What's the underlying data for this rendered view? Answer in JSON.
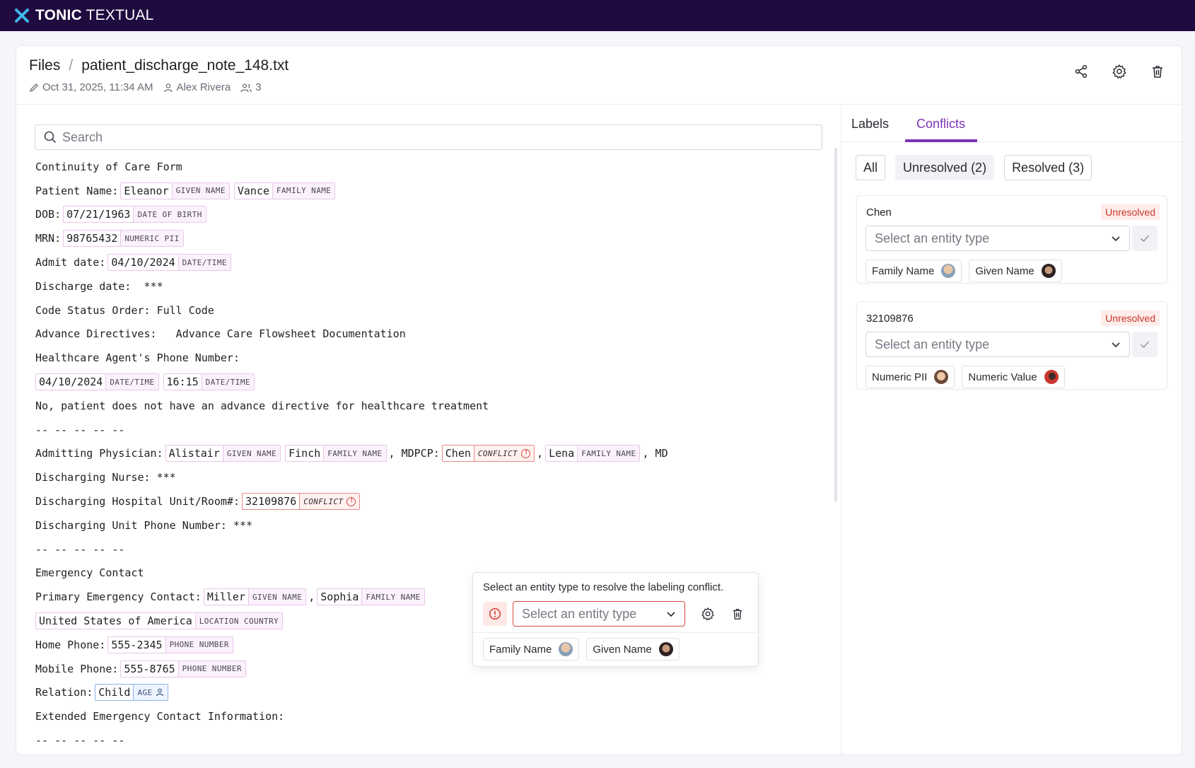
{
  "brand": {
    "name_bold": "TONIC",
    "name_rest": "TEXTUAL"
  },
  "breadcrumb": {
    "root": "Files",
    "separator": "/",
    "file": "patient_discharge_note_148.txt"
  },
  "meta": {
    "edited": "Oct 31, 2025, 11:34 AM",
    "user": "Alex Rivera",
    "collaborators": "3"
  },
  "search": {
    "placeholder": "Search"
  },
  "doc": {
    "l1": "Continuity of Care Form",
    "patient_name_label": "Patient Name:",
    "given1": "Eleanor",
    "given_tag": "GIVEN NAME",
    "family1": "Vance",
    "family_tag": "FAMILY NAME",
    "dob_label": "DOB:",
    "dob": "07/21/1963",
    "dob_tag": "DATE OF BIRTH",
    "mrn_label": "MRN:",
    "mrn": "98765432",
    "numeric_tag": "NUMERIC PII",
    "admit_label": "Admit date:",
    "admit": "04/10/2024",
    "datetime_tag": "DATE/TIME",
    "discharge": "Discharge date:  ***",
    "code": "Code Status Order: Full Code",
    "advance": "Advance Directives:   Advance Care Flowsheet Documentation",
    "agent": "Healthcare Agent's Phone Number:",
    "date2": "04/10/2024",
    "time2": "16:15",
    "no_directive": "No, patient does not have an advance directive for healthcare treatment",
    "dashes": "-- -- -- -- --",
    "admitting_label": "Admitting Physician:",
    "given2": "Alistair",
    "family2": "Finch",
    "comma": ",",
    "md": ", MD",
    "pcp_label": "PCP:",
    "conf1": "Chen",
    "conflict_tag": "CONFLICT",
    "family3": "Lena",
    "md2": ", MD",
    "nurse": "Discharging Nurse: ***",
    "unit_label": "Discharging Hospital Unit/Room#:",
    "conf2": "32109876",
    "unit_phone": "Discharging Unit Phone Number: ***",
    "emergency": "Emergency Contact",
    "primary_label": "Primary Emergency Contact:",
    "given3": "Miller",
    "family4": "Sophia",
    "country": "United States of America",
    "country_tag": "LOCATION COUNTRY",
    "home_label": "Home Phone:",
    "home": "555-2345",
    "phone_tag": "PHONE NUMBER",
    "mobile_label": "Mobile Phone:",
    "mobile": "555-8765",
    "relation_label": "Relation:",
    "relation": "Child",
    "age_tag": "AGE",
    "extended": "Extended Emergency Contact Information:"
  },
  "popover": {
    "message": "Select an entity type to resolve the labeling conflict.",
    "select_placeholder": "Select an entity type",
    "chips": [
      "Family Name",
      "Given Name"
    ]
  },
  "right": {
    "tabs": [
      "Labels",
      "Conflicts"
    ],
    "filters": [
      "All",
      "Unresolved (2)",
      "Resolved (3)"
    ],
    "conflicts": [
      {
        "title": "Chen",
        "status": "Unresolved",
        "placeholder": "Select an entity type",
        "chips": [
          "Family Name",
          "Given Name"
        ]
      },
      {
        "title": "32109876",
        "status": "Unresolved",
        "placeholder": "Select an entity type",
        "chips": [
          "Numeric PII",
          "Numeric Value"
        ]
      }
    ]
  },
  "colors": {
    "topbar": "#1f0b3f",
    "accent": "#7b33b8",
    "conflict": "#d8463d",
    "entity_border": "#e7c7ea"
  },
  "icons": [
    "logo-x-icon",
    "pencil-icon",
    "user-icon",
    "users-icon",
    "share-icon",
    "gear-icon",
    "trash-icon",
    "search-icon",
    "chevron-down-icon",
    "check-icon",
    "alert-circle-icon",
    "person-icon"
  ]
}
